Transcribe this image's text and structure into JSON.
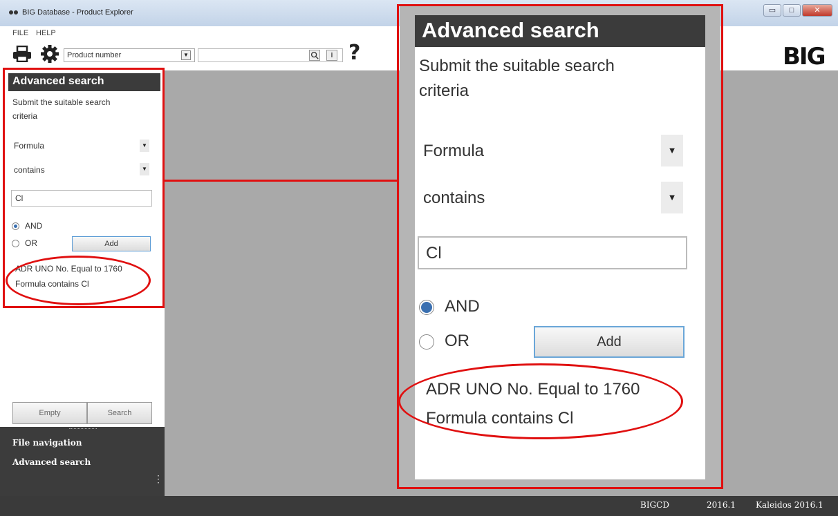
{
  "window": {
    "title": "BIG Database - Product Explorer",
    "minimize": "▭",
    "maximize": "□",
    "close": "✕"
  },
  "menu": {
    "file": "FILE",
    "help": "HELP"
  },
  "toolbar": {
    "field_select_value": "Product number",
    "search_value": "",
    "info_glyph": "i",
    "help_glyph": "?",
    "logo": "BIG"
  },
  "advanced_search": {
    "title": "Advanced search",
    "instructions": "Submit the suitable search criteria",
    "field_value": "Formula",
    "operator_value": "contains",
    "search_value": "Cl",
    "and_label": "AND",
    "or_label": "OR",
    "selected_logic": "AND",
    "add_label": "Add",
    "criteria": [
      "ADR UNO No. Equal to 1760",
      "Formula contains Cl"
    ],
    "empty_label": "Empty",
    "search_label": "Search"
  },
  "navigation": {
    "items": [
      "File navigation",
      "Advanced search"
    ]
  },
  "status_bar": {
    "db": "BIGCD",
    "version": "2016.1",
    "product": "Kaleidos 2016.1"
  },
  "colors": {
    "header_dark": "#3b3b3b",
    "annotation_red": "#e01010",
    "workspace_gray": "#a9a9a9",
    "radio_selected": "#3a6fb0"
  }
}
